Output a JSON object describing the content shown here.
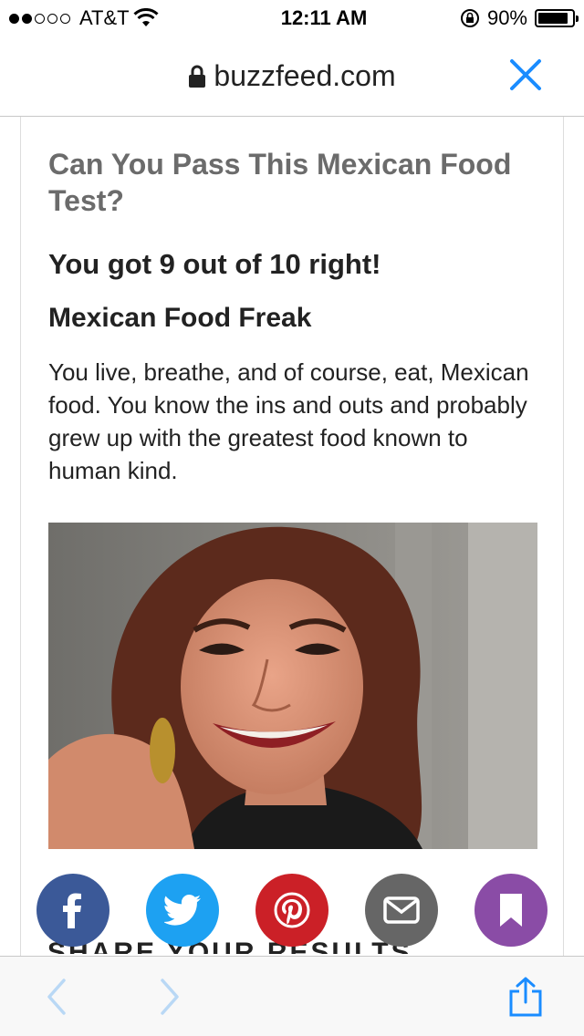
{
  "status": {
    "carrier": "AT&T",
    "time": "12:11 AM",
    "battery": "90%",
    "battery_level": 0.9
  },
  "browser": {
    "url": "buzzfeed.com"
  },
  "quiz": {
    "title": "Can You Pass This Mexican Food Test?",
    "score": "You got 9 out of 10 right!",
    "result_title": "Mexican Food Freak",
    "result_description": "You live, breathe, and of course, eat, Mexican food. You know the ins and outs and probably grew up with the greatest food known to human kind."
  },
  "share": {
    "heading": "SHARE YOUR RESULTS",
    "buttons": [
      {
        "name": "facebook",
        "color": "#3b5998"
      },
      {
        "name": "twitter",
        "color": "#1da1f2"
      },
      {
        "name": "pinterest",
        "color": "#cb2027"
      },
      {
        "name": "email",
        "color": "#666666"
      },
      {
        "name": "bookmark",
        "color": "#8a4ca6"
      }
    ]
  },
  "colors": {
    "ios_blue": "#1a8cff"
  }
}
